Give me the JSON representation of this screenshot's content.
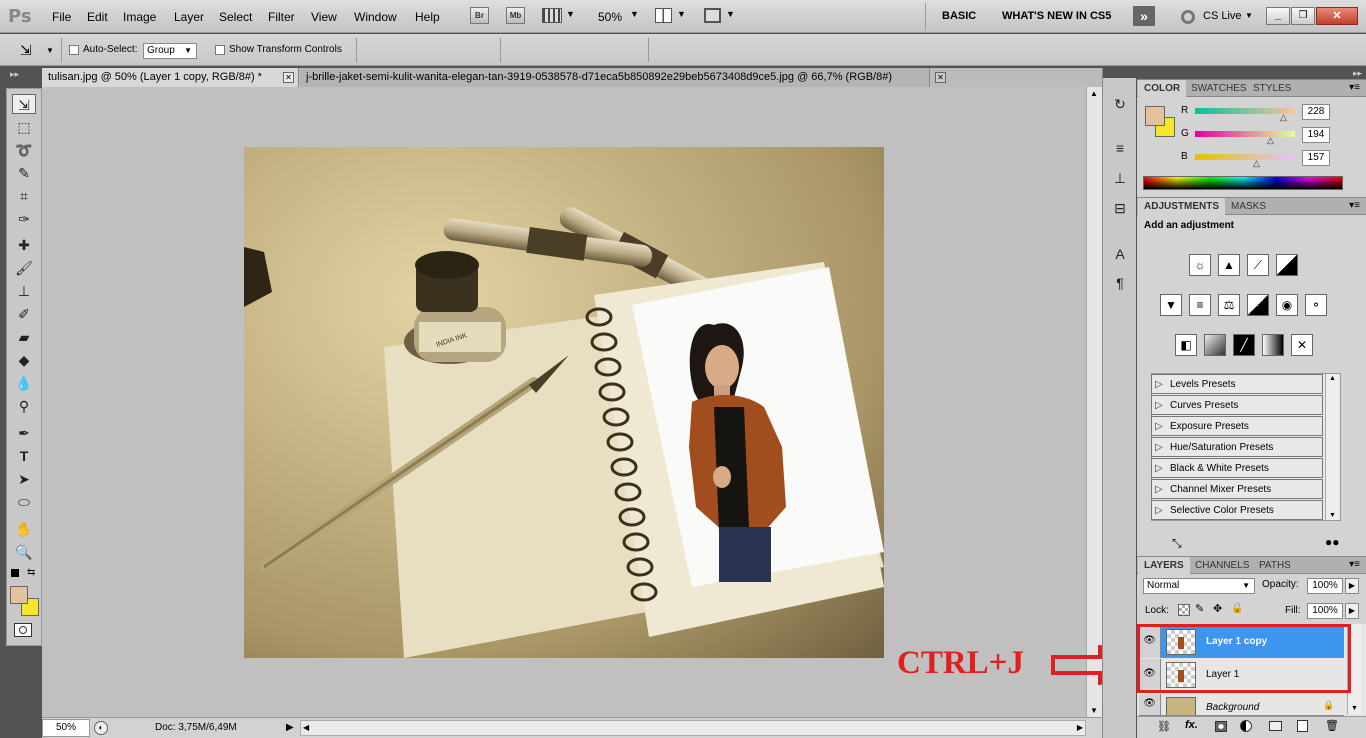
{
  "menu": {
    "logo": "Ps",
    "items": [
      "File",
      "Edit",
      "Image",
      "Layer",
      "Select",
      "Filter",
      "View",
      "Window",
      "Help"
    ],
    "br": "Br",
    "mb": "Mb",
    "zoom": "50%",
    "workspaces": {
      "basic": "BASIC",
      "whats_new": "WHAT'S NEW IN CS5"
    },
    "cs_live": "CS Live"
  },
  "options": {
    "auto_select_label": "Auto-Select:",
    "auto_select_value": "Group",
    "transform_label": "Show Transform Controls"
  },
  "tabs": [
    {
      "label": "tulisan.jpg @ 50% (Layer 1 copy, RGB/8#) *",
      "active": true
    },
    {
      "label": "j-brille-jaket-semi-kulit-wanita-elegan-tan-3919-0538578-d71eca5b850892e29beb5673408d9ce5.jpg @ 66,7% (RGB/8#)",
      "active": false
    }
  ],
  "status": {
    "zoom": "50%",
    "doc": "Doc: 3,75M/6,49M"
  },
  "color_panel": {
    "tabs": [
      "COLOR",
      "SWATCHES",
      "STYLES"
    ],
    "r_label": "R",
    "g_label": "G",
    "b_label": "B",
    "r": "228",
    "g": "194",
    "b": "157",
    "fg": "#e4c29d",
    "bg": "#f5e52b",
    "r_pos": 0.89,
    "g_pos": 0.76,
    "b_pos": 0.62
  },
  "adjustments": {
    "tabs": [
      "ADJUSTMENTS",
      "MASKS"
    ],
    "heading": "Add an adjustment",
    "presets": [
      "Levels Presets",
      "Curves Presets",
      "Exposure Presets",
      "Hue/Saturation Presets",
      "Black & White Presets",
      "Channel Mixer Presets",
      "Selective Color Presets"
    ]
  },
  "layers": {
    "tabs": [
      "LAYERS",
      "CHANNELS",
      "PATHS"
    ],
    "blend": "Normal",
    "opacity_label": "Opacity:",
    "opacity": "100%",
    "lock_label": "Lock:",
    "fill_label": "Fill:",
    "fill": "100%",
    "items": [
      {
        "name": "Layer 1 copy",
        "selected": true
      },
      {
        "name": "Layer 1",
        "selected": false
      },
      {
        "name": "Background",
        "selected": false
      }
    ]
  },
  "annotation": {
    "text": "CTRL+J",
    "color": "#e02020"
  },
  "photo": {
    "ink_label": "INDIA INK"
  }
}
